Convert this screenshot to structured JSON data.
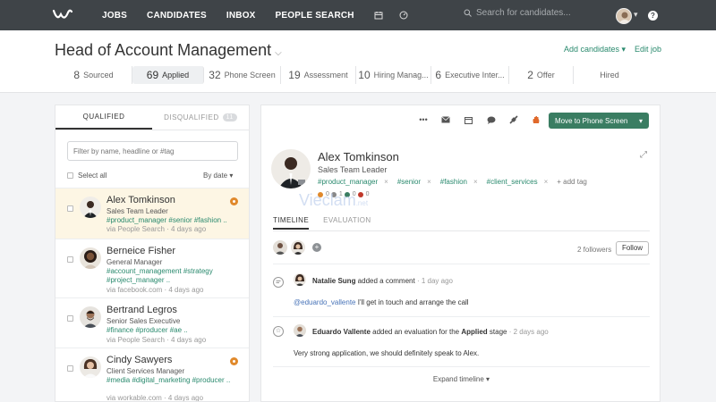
{
  "nav": {
    "links": [
      "JOBS",
      "CANDIDATES",
      "INBOX",
      "PEOPLE SEARCH"
    ],
    "search_placeholder": "Search for candidates...",
    "help": "?"
  },
  "job": {
    "title": "Head of Account Management",
    "add_candidates": "Add candidates ▾",
    "edit_job": "Edit job",
    "stages": [
      {
        "num": "8",
        "label": "Sourced"
      },
      {
        "num": "69",
        "label": "Applied"
      },
      {
        "num": "32",
        "label": "Phone Screen"
      },
      {
        "num": "19",
        "label": "Assessment"
      },
      {
        "num": "10",
        "label": "Hiring Manag..."
      },
      {
        "num": "6",
        "label": "Executive Inter..."
      },
      {
        "num": "2",
        "label": "Offer"
      },
      {
        "num": "",
        "label": "Hired"
      }
    ]
  },
  "list": {
    "tab_qualified": "QUALIFIED",
    "tab_disqualified": "DISQUALIFIED",
    "disqualified_count": "11",
    "filter_placeholder": "Filter by name, headline or #tag",
    "select_all": "Select all",
    "sort": "By date ▾",
    "candidates": [
      {
        "name": "Alex Tomkinson",
        "role": "Sales Team Leader",
        "tags": "#product_manager #senior #fashion ..",
        "source": "via People Search · 4 days ago"
      },
      {
        "name": "Berneice Fisher",
        "role": "General Manager",
        "tags": "#account_management #strategy #project_manager ..",
        "source": "via facebook.com · 4 days ago"
      },
      {
        "name": "Bertrand Legros",
        "role": "Senior Sales Executive",
        "tags": "#finance #producer #ae ..",
        "source": "via People Search · 4 days ago"
      },
      {
        "name": "Cindy Sawyers",
        "role": "Client Services Manager",
        "tags": "#media #digital_marketing #producer ..",
        "source": "via workable.com · 4 days ago"
      }
    ]
  },
  "profile": {
    "move_button": "Move to Phone Screen",
    "name": "Alex Tomkinson",
    "role": "Sales Team Leader",
    "tags": [
      "#product_manager",
      "#senior",
      "#fashion",
      "#client_services"
    ],
    "add_tag": "+ add tag",
    "ratings": [
      "0",
      "1",
      "0",
      "0"
    ],
    "watermark": "Vieclam",
    "watermark_sub": ".net",
    "tab_timeline": "TIMELINE",
    "tab_evaluation": "EVALUATION",
    "followers": "2 followers",
    "follow": "Follow",
    "activity": [
      {
        "author": "Natalie Sung",
        "action": " added a comment",
        "time": " · 1 day ago",
        "mention": "@eduardo_vallente",
        "body": " I'll get in touch and arrange the call"
      },
      {
        "author": "Eduardo Vallente",
        "action": " added an evaluation for the ",
        "stage": "Applied",
        "action2": " stage",
        "time": " · 2 days ago",
        "body": "Very strong application, we should definitely speak to Alex."
      }
    ],
    "expand": "Expand timeline ▾"
  },
  "colors": {
    "nav_bg": "#3f4448",
    "accent_green": "#3a7d62",
    "tag_green": "#2a8a6e",
    "flag_orange": "#e0892b",
    "selected_row": "#fdf6e4"
  }
}
